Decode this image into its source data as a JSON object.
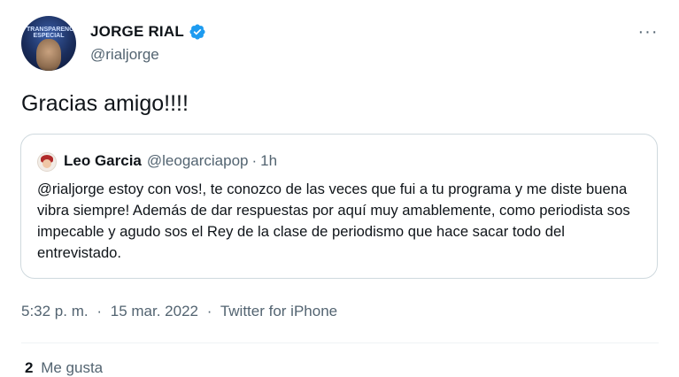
{
  "author": {
    "display_name": "JORGE RIAL",
    "handle": "@rialjorge",
    "avatar_banner": "TRANSPARENCIA ESPECIAL",
    "verified_icon": "verified-badge-icon"
  },
  "more_button": "···",
  "tweet": {
    "text": "Gracias amigo!!!!"
  },
  "quoted": {
    "name": "Leo Garcia",
    "handle": "@leogarciapop",
    "separator": "·",
    "time": "1h",
    "body": "@rialjorge estoy con vos!, te conozco de las veces que fui a tu programa y me diste buena vibra siempre! Además de dar respuestas por aquí muy amablemente, como periodista sos impecable y agudo sos el Rey de la clase de periodismo que hace sacar todo del entrevistado."
  },
  "meta": {
    "time": "5:32 p. m.",
    "sep": "·",
    "date": "15 mar. 2022",
    "source": "Twitter for iPhone"
  },
  "stats": {
    "likes_count": "2",
    "likes_label": "Me gusta"
  },
  "colors": {
    "accent": "#1d9bf0",
    "text": "#0f1419",
    "muted": "#536471",
    "border": "#cfd9de"
  }
}
